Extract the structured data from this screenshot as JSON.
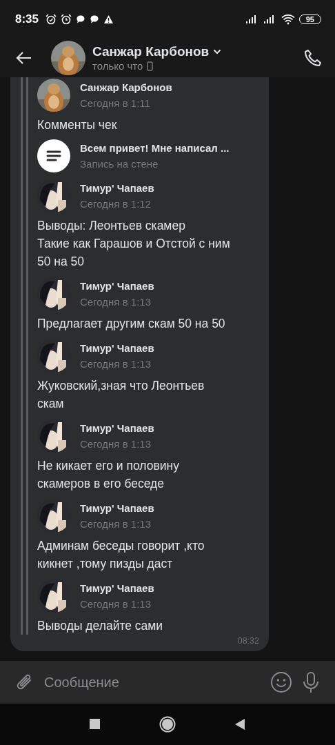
{
  "status_bar": {
    "time": "8:35",
    "battery": "95"
  },
  "header": {
    "name": "Санжар Карбонов",
    "status": "только что"
  },
  "bubble": {
    "time": "08:32",
    "messages": [
      {
        "kind": "marmot",
        "author": "Санжар Карбонов",
        "time": "Сегодня в 1:11",
        "lines": [
          "Комменты чек"
        ],
        "attachment": {
          "title": "Всем привет! Мне написал ...",
          "subtitle": "Запись на стене"
        }
      },
      {
        "kind": "anime",
        "author": "Тимур' Чапаев",
        "time": "Сегодня в 1:12",
        "lines": [
          "Выводы: Леонтьев скамер",
          "Такие как Гарашов и Отстой с ним",
          "50 на 50"
        ]
      },
      {
        "kind": "anime",
        "author": "Тимур' Чапаев",
        "time": "Сегодня в 1:13",
        "lines": [
          "Предлагает другим скам 50 на 50"
        ]
      },
      {
        "kind": "anime",
        "author": "Тимур' Чапаев",
        "time": "Сегодня в 1:13",
        "lines": [
          "Жуковский,зная что Леонтьев",
          "скам"
        ]
      },
      {
        "kind": "anime",
        "author": "Тимур' Чапаев",
        "time": "Сегодня в 1:13",
        "lines": [
          "Не кикает его и половину",
          "скамеров в его беседе"
        ]
      },
      {
        "kind": "anime",
        "author": "Тимур' Чапаев",
        "time": "Сегодня в 1:13",
        "lines": [
          "Админам беседы говорит ,кто",
          "кикнет ,тому пизды даст"
        ]
      },
      {
        "kind": "anime",
        "author": "Тимур' Чапаев",
        "time": "Сегодня в 1:13",
        "lines": [
          "Выводы делайте сами"
        ]
      }
    ]
  },
  "composer": {
    "placeholder": "Сообщение"
  }
}
